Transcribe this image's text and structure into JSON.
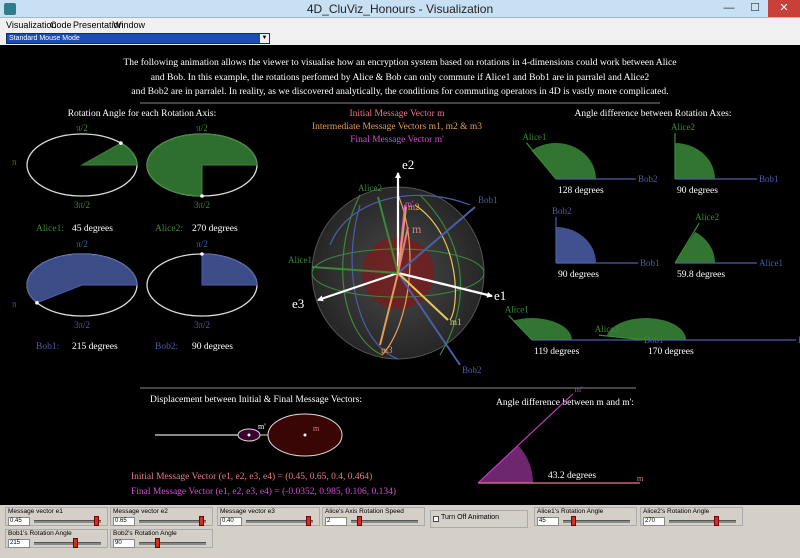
{
  "window": {
    "title": "4D_CluViz_Honours - Visualization",
    "min": "—",
    "max": "☐",
    "close": "✕"
  },
  "menu": [
    "Visualization",
    "Code",
    "Presentation",
    "Window"
  ],
  "mode_select": "Standard Mouse Mode",
  "description": [
    "The following animation allows the viewer to visualise how an encryption system based on rotations in 4-dimensions could work between Alice",
    "and Bob. In this example, the rotations perfomed by Alice & Bob can only commute if Alice1 and Bob1 are in parralel and Alice2",
    "and Bob2 are in parralel. In reality, as we discovered analytically, the conditions for commuting operators in 4D is vastly more complicated."
  ],
  "left_title": "Rotation Angle for each Rotation Axis:",
  "pi_half": "π/2",
  "three_pi_half": "3π/2",
  "pi": "π",
  "angles": [
    {
      "name": "Alice1:",
      "value": "45 degrees",
      "deg": 45,
      "color": "#3a8a3a"
    },
    {
      "name": "Alice2:",
      "value": "270 degrees",
      "deg": 270,
      "color": "#3a8a3a"
    },
    {
      "name": "Bob1:",
      "value": "215 degrees",
      "deg": 215,
      "color": "#4a5fa8"
    },
    {
      "name": "Bob2:",
      "value": "90 degrees",
      "deg": 90,
      "color": "#4a5fa8"
    }
  ],
  "center_legend": {
    "initial": "Initial Message Vector m",
    "intermediate": "Intermediate Message Vectors m1, m2 & m3",
    "final": "Final Message Vector m'"
  },
  "axes": {
    "e1": "e1",
    "e2": "e2",
    "e3": "e3"
  },
  "vector_labels": {
    "alice1": "Alice1",
    "alice2": "Alice2",
    "bob1": "Bob1",
    "bob2": "Bob2",
    "m": "m",
    "m1": "m1",
    "m2": "m2",
    "m3": "m3",
    "mprime": "m'"
  },
  "right_title": "Angle difference between Rotation Axes:",
  "differences": [
    {
      "a": "Alice1",
      "b": "Bob2",
      "value": "128 degrees",
      "deg": 128,
      "fill": "green"
    },
    {
      "a": "Alice2",
      "b": "Bob1",
      "value": "90 degrees",
      "deg": 90,
      "fill": "green"
    },
    {
      "a": "Bob2",
      "b": "Bob1",
      "value": "90 degrees",
      "deg": 90,
      "fill": "blue"
    },
    {
      "a": "Alice2",
      "b": "Alice1",
      "value": "59.8 degrees",
      "deg": 59.8,
      "fill": "green"
    },
    {
      "a": "Alice1",
      "b": "Bob1",
      "value": "119 degrees",
      "deg": 119,
      "fill": "green"
    },
    {
      "a": "Alice2",
      "b": "Bob2",
      "value": "170 degrees",
      "deg": 170,
      "fill": "green"
    }
  ],
  "displacement_title": "Displacement between Initial & Final Message Vectors:",
  "disp_labels": {
    "mprime": "m'",
    "m": "m"
  },
  "initial_vector": "Initial Message Vector (e1, e2, e3, e4) = (0.45, 0.65, 0.4, 0.464)",
  "final_vector": "Final Message Vector (e1, e2, e3, e4) = (-0.0352, 0.985, 0.106, 0.134)",
  "angle_m_title": "Angle difference between m and m':",
  "angle_m": {
    "value": "43.2 degrees",
    "deg": 43.2,
    "m": "m",
    "mprime": "m'"
  },
  "colors": {
    "green": "#3a8a3a",
    "blue": "#4a5fa8",
    "pink": "#e87a8a",
    "orange": "#e89a5a",
    "magenta": "#d050d0",
    "white": "#ffffff"
  },
  "controls": [
    {
      "label": "Message vector e1",
      "value": "0.45",
      "pos": 0.95
    },
    {
      "label": "Message vector e2",
      "value": "0.65",
      "pos": 0.95
    },
    {
      "label": "Message vector e3",
      "value": "0.40",
      "pos": 0.95
    },
    {
      "label": "Alice's Axis Rotation Speed",
      "value": "2",
      "pos": 0.1
    },
    {
      "label": "Alice1's Rotation Angle",
      "value": "45",
      "pos": 0.12
    },
    {
      "label": "Alice2's Rotation Angle",
      "value": "270",
      "pos": 0.72
    },
    {
      "label": "Bob1's Rotation Angle",
      "value": "215",
      "pos": 0.62
    },
    {
      "label": "Bob2's Rotation Angle",
      "value": "90",
      "pos": 0.25
    }
  ],
  "toggle": "Turn Off Animation"
}
